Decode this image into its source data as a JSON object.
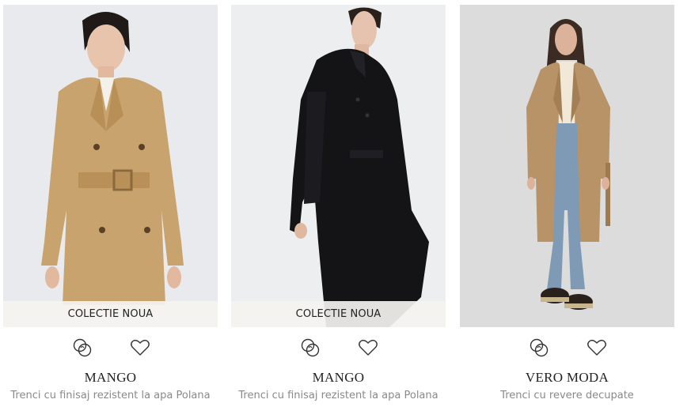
{
  "products": [
    {
      "badge": "COLECTIE NOUA",
      "brand": "MANGO",
      "name": "Trenci cu finisaj rezistent la apa Polana",
      "photo_background": "#ecedef",
      "coat_color": "#c9a36d"
    },
    {
      "badge": "COLECTIE NOUA",
      "brand": "MANGO",
      "name": "Trenci cu finisaj rezistent la apa Polana",
      "photo_background": "#eceeef",
      "coat_color": "#141416"
    },
    {
      "brand": "VERO MODA",
      "name": "Trenci cu revere decupate",
      "photo_background": "#dcdcdd",
      "coat_color": "#b99368"
    }
  ],
  "icons": {
    "compare": "compare-rings-icon",
    "wishlist": "heart-outline-icon"
  }
}
